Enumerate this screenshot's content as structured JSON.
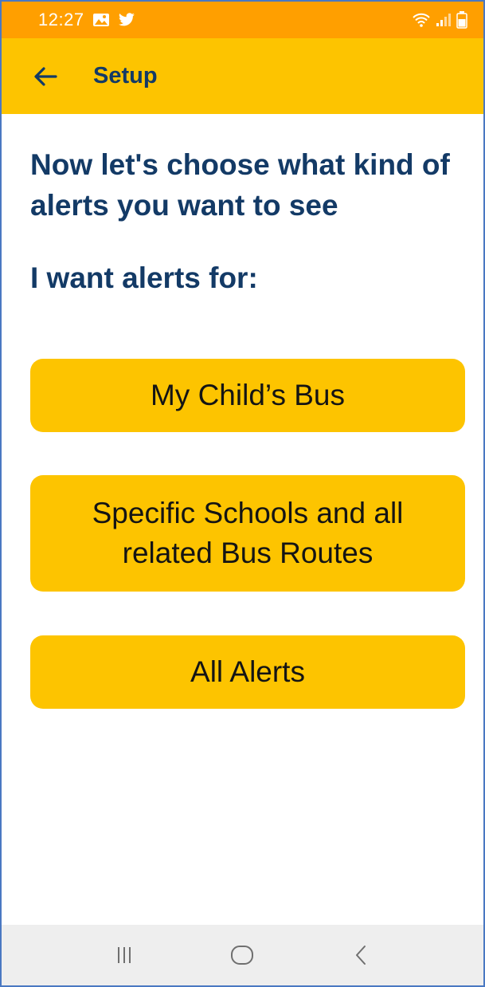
{
  "status_bar": {
    "time": "12:27",
    "left_icons": [
      "gallery-icon",
      "twitter-icon"
    ],
    "right_icons": [
      "wifi-icon",
      "signal-icon",
      "battery-icon"
    ],
    "color": "#ff9f00"
  },
  "app_bar": {
    "title": "Setup",
    "back_icon": "arrow-left-icon",
    "color": "#fdc400"
  },
  "main": {
    "headline": "Now let's choose what kind of alerts you want to see",
    "subhead": "I want alerts for:",
    "options": [
      {
        "label": "My Child’s Bus"
      },
      {
        "label": "Specific Schools and all related Bus Routes"
      },
      {
        "label": "All Alerts"
      }
    ],
    "text_color": "#133a66",
    "button_color": "#fdc400"
  },
  "nav_bar": {
    "buttons": [
      "recent-apps-icon",
      "home-icon",
      "back-icon"
    ]
  }
}
